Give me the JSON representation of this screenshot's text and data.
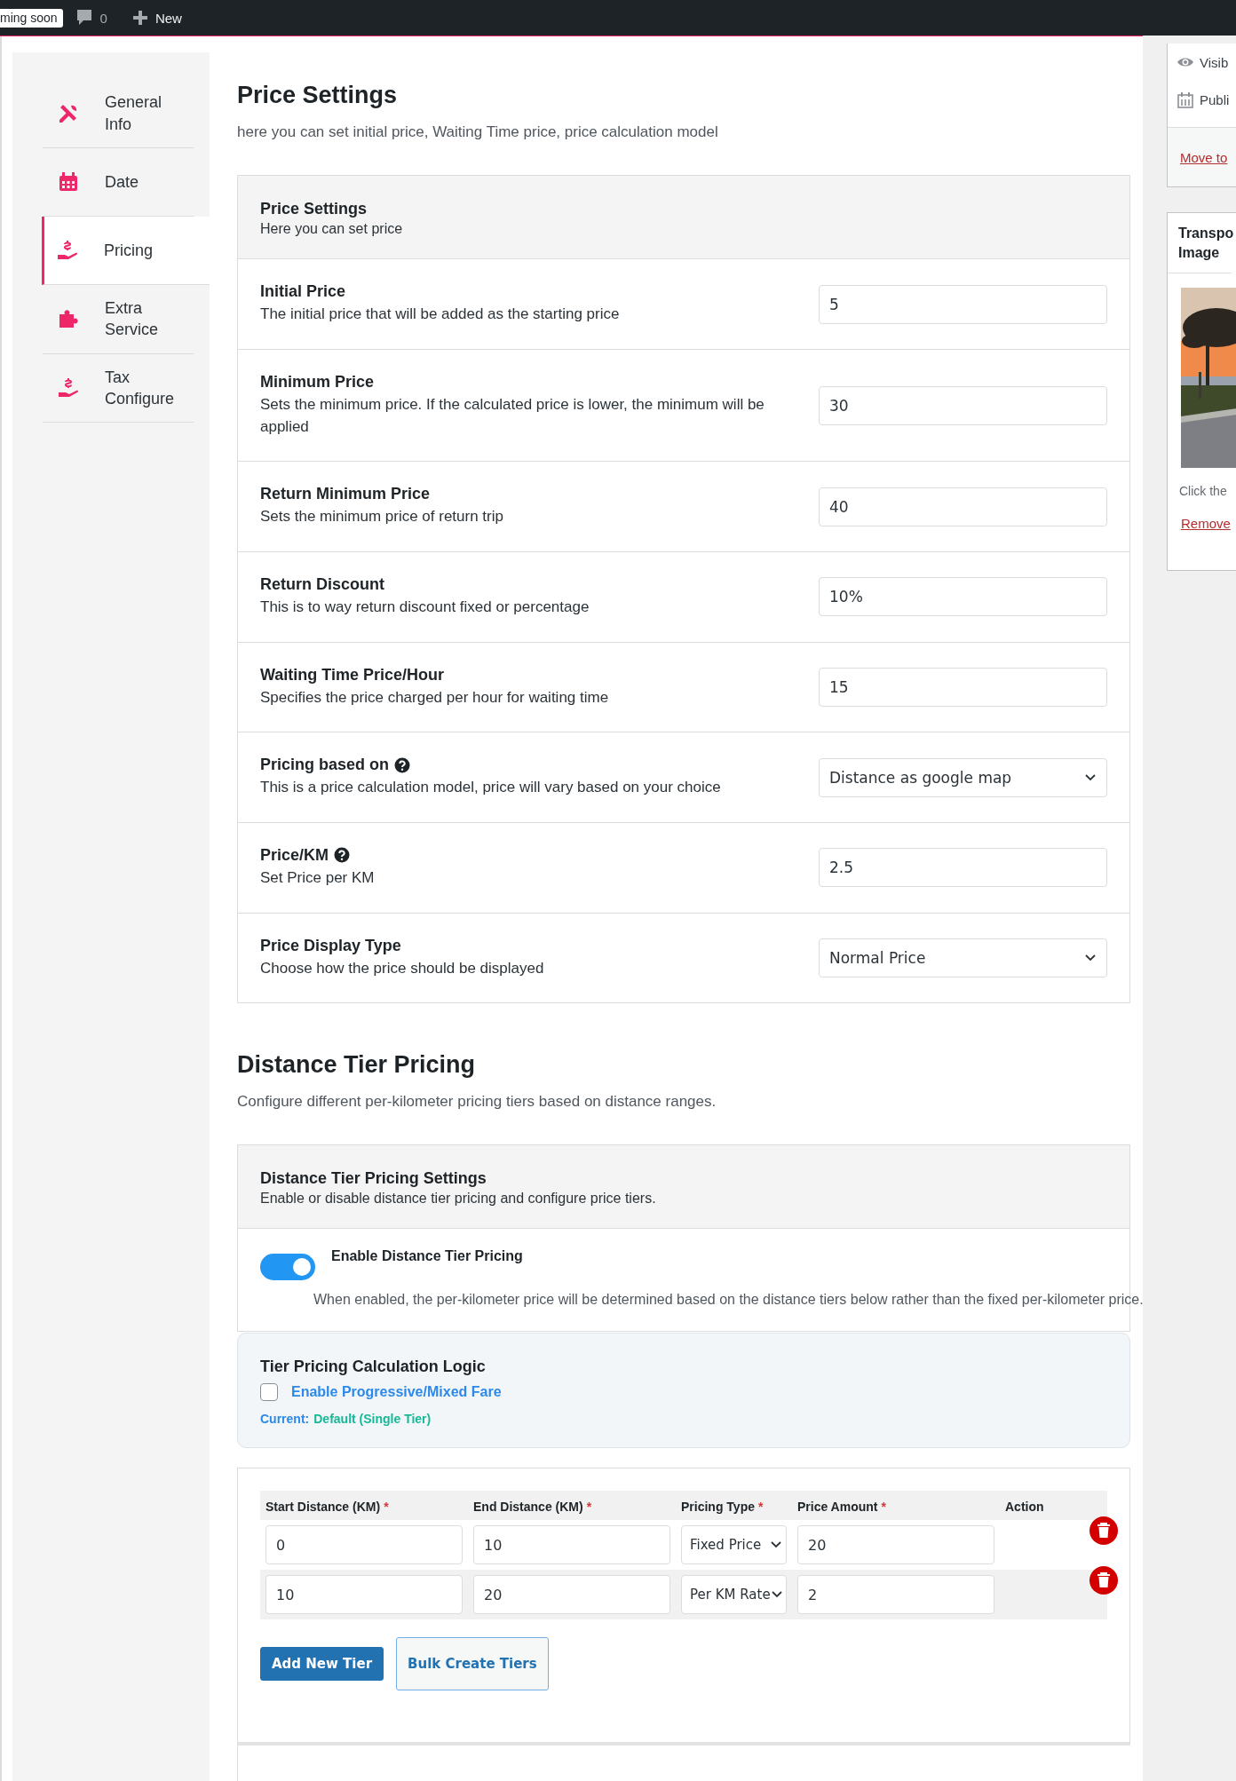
{
  "admin_bar": {
    "badge": "ming soon",
    "comments": "0",
    "new_label": "New"
  },
  "sidebar": {
    "items": [
      {
        "label": "General Info",
        "kind": "tools",
        "selected": false
      },
      {
        "label": "Date",
        "kind": "calendar",
        "selected": false
      },
      {
        "label": "Pricing",
        "kind": "hand-dollar",
        "selected": true
      },
      {
        "label": "Extra Service",
        "kind": "puzzle",
        "selected": false
      },
      {
        "label": "Tax Configure",
        "kind": "hand-dollar",
        "selected": false
      }
    ]
  },
  "price_section": {
    "title": "Price Settings",
    "description": "here you can set initial price, Waiting Time price, price calculation model",
    "card": {
      "title": "Price Settings",
      "subtitle": "Here you can set price",
      "rows": [
        {
          "kind": "input",
          "label": "Initial Price",
          "has_help": false,
          "description": "The initial price that will be added as the starting price",
          "value": "5"
        },
        {
          "kind": "input",
          "label": "Minimum Price",
          "has_help": false,
          "description": "Sets the minimum price. If the calculated price is lower, the minimum will be applied",
          "value": "30"
        },
        {
          "kind": "input",
          "label": "Return Minimum Price",
          "has_help": false,
          "description": "Sets the minimum price of return trip",
          "value": "40"
        },
        {
          "kind": "input",
          "label": "Return Discount",
          "has_help": false,
          "description": "This is to way return discount fixed or percentage",
          "value": "10%"
        },
        {
          "kind": "input",
          "label": "Waiting Time Price/Hour",
          "has_help": false,
          "description": "Specifies the price charged per hour for waiting time",
          "value": "15"
        },
        {
          "kind": "select",
          "label": "Pricing based on",
          "has_help": true,
          "description": "This is a price calculation model, price will vary based on your choice",
          "value": "Distance as google map"
        },
        {
          "kind": "input",
          "label": "Price/KM",
          "has_help": true,
          "description": "Set Price per KM",
          "value": "2.5"
        },
        {
          "kind": "select",
          "label": "Price Display Type",
          "has_help": false,
          "description": "Choose how the price should be displayed",
          "value": "Normal Price"
        }
      ]
    }
  },
  "tier_section": {
    "title": "Distance Tier Pricing",
    "description": "Configure different per-kilometer pricing tiers based on distance ranges.",
    "card": {
      "title": "Distance Tier Pricing Settings",
      "subtitle": "Enable or disable distance tier pricing and configure price tiers.",
      "toggle": {
        "label": "Enable Distance Tier Pricing",
        "on": true,
        "hint": "When enabled, the per-kilometer price will be determined based on the distance tiers below rather than the fixed per-kilometer price."
      }
    },
    "logic": {
      "title": "Tier Pricing Calculation Logic",
      "checkbox": {
        "label": "Enable Progressive/Mixed Fare",
        "checked": false
      },
      "current_label": "Current:",
      "current_value": "Default (Single Tier)"
    },
    "table": {
      "columns": [
        {
          "label": "Start Distance (KM)",
          "required_mark": "*"
        },
        {
          "label": "End Distance (KM)",
          "required_mark": "*"
        },
        {
          "label": "Pricing Type",
          "required_mark": "*"
        },
        {
          "label": "Price Amount",
          "required_mark": "*"
        },
        {
          "label": "Action"
        }
      ],
      "rows": [
        {
          "cells": [
            {
              "kind": "input",
              "value": "0"
            },
            {
              "kind": "input",
              "value": "10"
            },
            {
              "kind": "select",
              "value": "Fixed Price"
            },
            {
              "kind": "input",
              "value": "20"
            }
          ]
        },
        {
          "cells": [
            {
              "kind": "input",
              "value": "10"
            },
            {
              "kind": "input",
              "value": "20"
            },
            {
              "kind": "select",
              "value": "Per KM Rate"
            },
            {
              "kind": "input",
              "value": "2"
            }
          ]
        }
      ]
    },
    "buttons": [
      {
        "label": "Add New Tier",
        "kind": "primary"
      },
      {
        "label": "Bulk Create Tiers",
        "kind": "secondary"
      }
    ]
  },
  "side_panel": {
    "publish": {
      "items": [
        {
          "kind": "eye",
          "label": "Visib"
        },
        {
          "kind": "calendar",
          "label": "Publi"
        }
      ],
      "trash_link": "Move to"
    },
    "image_box": {
      "title": "Transpo Image",
      "hint": "Click the",
      "remove_link": "Remove"
    }
  }
}
